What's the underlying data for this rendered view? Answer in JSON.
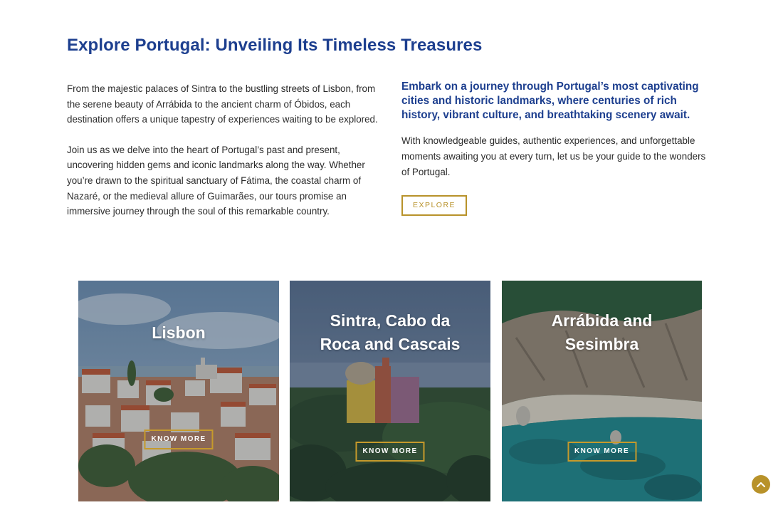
{
  "section": {
    "title": "Explore Portugal: Unveiling Its Timeless Treasures"
  },
  "intro": {
    "paragraph1": "From the majestic palaces of Sintra to the bustling streets of Lisbon, from the serene beauty of Arrábida to the ancient charm of Óbidos, each destination offers a unique tapestry of experiences waiting to be explored.",
    "paragraph2": "Join us as we delve into the heart of Portugal’s past and present, uncovering hidden gems and iconic landmarks along the way. Whether you’re drawn to the spiritual sanctuary of Fátima, the coastal charm of Nazaré, or the medieval allure of Guimarães, our tours promise an immersive journey through the soul of this remarkable country."
  },
  "highlight": {
    "lead": "Embark on a journey through Portugal’s most captivating cities and historic landmarks, where centuries of rich history, vibrant culture, and breathtaking scenery await.",
    "body": "With knowledgeable guides, authentic experiences, and unforgettable moments awaiting you at every turn, let us be your guide to the wonders of Portugal.",
    "explore_label": "EXPLORE"
  },
  "cards": [
    {
      "title": "Lisbon",
      "button_label": "KNOW MORE"
    },
    {
      "title": "Sintra, Cabo da Roca and Cascais",
      "button_label": "KNOW MORE"
    },
    {
      "title": "Arrábida and Sesimbra",
      "button_label": "KNOW MORE"
    }
  ],
  "colors": {
    "heading_blue": "#1d3f8f",
    "accent_gold": "#b8922a",
    "body_text": "#2b2b2b"
  },
  "icons": {
    "scroll_top": "chevron-up-icon"
  }
}
